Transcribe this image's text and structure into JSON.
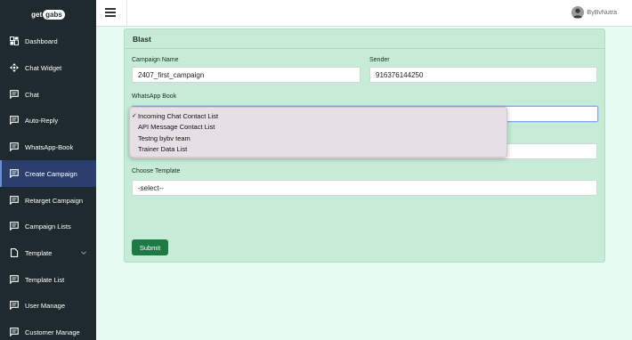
{
  "logo": {
    "text1": "get",
    "text2": "gabs"
  },
  "sidebar": {
    "items": [
      {
        "label": "Dashboard",
        "icon": "dashboard-icon"
      },
      {
        "label": "Chat Widget",
        "icon": "move-icon"
      },
      {
        "label": "Chat",
        "icon": "message-icon"
      },
      {
        "label": "Auto-Reply",
        "icon": "message-icon"
      },
      {
        "label": "WhatsApp-Book",
        "icon": "message-icon"
      },
      {
        "label": "Create Campaign",
        "icon": "message-icon",
        "active": true
      },
      {
        "label": "Retarget Campaign",
        "icon": "message-icon"
      },
      {
        "label": "Campaign Lists",
        "icon": "message-icon"
      },
      {
        "label": "Template",
        "icon": "file-icon",
        "expandable": true
      },
      {
        "label": "Template List",
        "icon": "message-icon"
      },
      {
        "label": "User Manage",
        "icon": "message-icon"
      },
      {
        "label": "Customer Manage",
        "icon": "message-icon"
      }
    ]
  },
  "topbar": {
    "user_name": "ByBvNutra"
  },
  "form": {
    "title": "Blast",
    "campaign_name_label": "Campaign Name",
    "campaign_name_value": "2407_first_campaign",
    "sender_label": "Sender",
    "sender_value": "916376144250",
    "whatsapp_book_label": "WhatsApp Book",
    "choose_template_label": "Choose Template",
    "choose_template_value": "-select--",
    "submit_label": "Submit"
  },
  "dropdown": {
    "options": [
      {
        "label": "Incoming Chat Contact List",
        "selected": true
      },
      {
        "label": "API Message Contact List"
      },
      {
        "label": "Testng bybv team"
      },
      {
        "label": "Trainer Data List"
      }
    ],
    "check_mark": "✓"
  },
  "colors": {
    "sidebar_bg": "#1e2a2e",
    "active_bg": "#2a3f6e",
    "card_bg": "#c6ecd7",
    "submit_bg": "#1e7a45",
    "page_bg": "#e6fcf2"
  }
}
